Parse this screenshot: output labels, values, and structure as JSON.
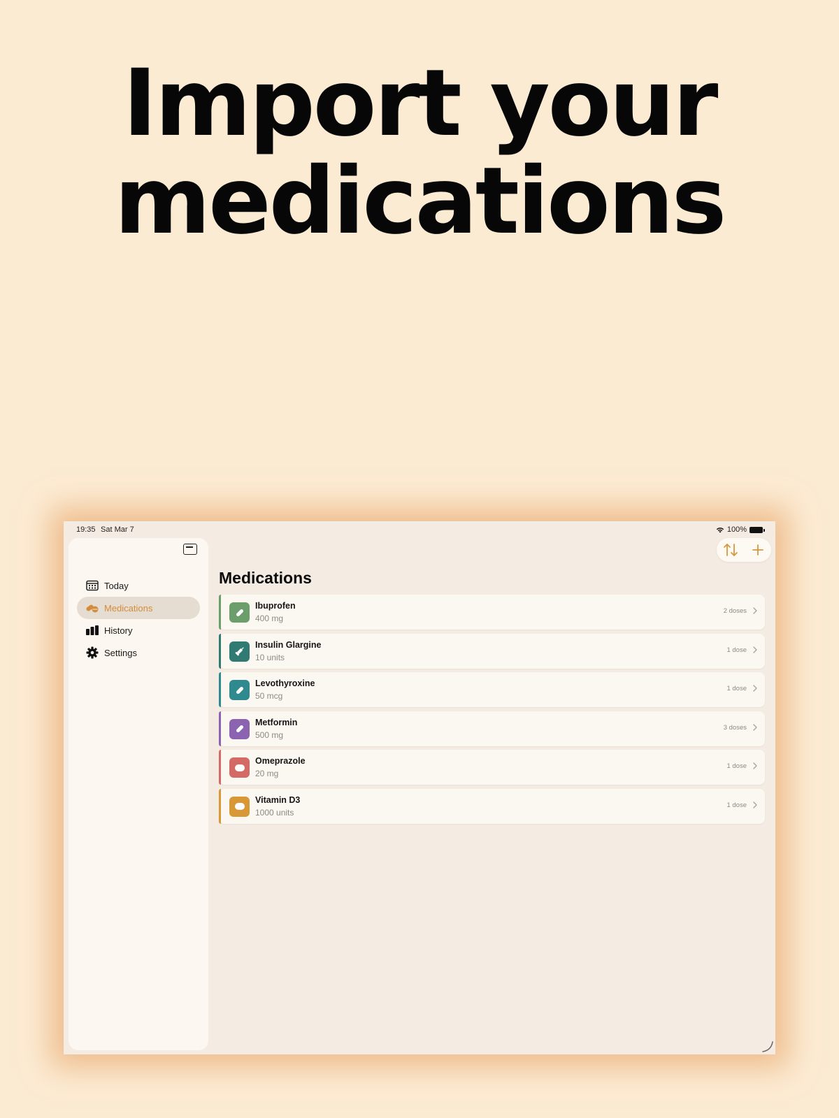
{
  "headline": {
    "line1": "Import your",
    "line2": "medications"
  },
  "status_bar": {
    "time": "19:35",
    "date": "Sat Mar 7",
    "battery": "100%"
  },
  "sidebar": {
    "items": [
      {
        "label": "Today",
        "icon": "calendar-icon",
        "active": false
      },
      {
        "label": "Medications",
        "icon": "pills-icon",
        "active": true
      },
      {
        "label": "History",
        "icon": "bar-chart-icon",
        "active": false
      },
      {
        "label": "Settings",
        "icon": "gear-icon",
        "active": false
      }
    ]
  },
  "main": {
    "title": "Medications"
  },
  "toolbar": {
    "sort_icon": "sort-arrows-icon",
    "add_icon": "plus-icon",
    "accent": "#d9963f"
  },
  "medications": [
    {
      "name": "Ibuprofen",
      "dose": "400 mg",
      "count": "2 doses",
      "color": "#6b9e6a",
      "icon": "pill-icon"
    },
    {
      "name": "Insulin Glargine",
      "dose": "10 units",
      "count": "1 dose",
      "color": "#2f7a72",
      "icon": "syringe-icon"
    },
    {
      "name": "Levothyroxine",
      "dose": "50 mcg",
      "count": "1 dose",
      "color": "#2f8a8f",
      "icon": "pill-icon"
    },
    {
      "name": "Metformin",
      "dose": "500 mg",
      "count": "3 doses",
      "color": "#8b63b0",
      "icon": "pill-icon"
    },
    {
      "name": "Omeprazole",
      "dose": "20 mg",
      "count": "1 dose",
      "color": "#d46a66",
      "icon": "tablet-icon"
    },
    {
      "name": "Vitamin D3",
      "dose": "1000 units",
      "count": "1 dose",
      "color": "#d99836",
      "icon": "tablet-icon"
    }
  ]
}
